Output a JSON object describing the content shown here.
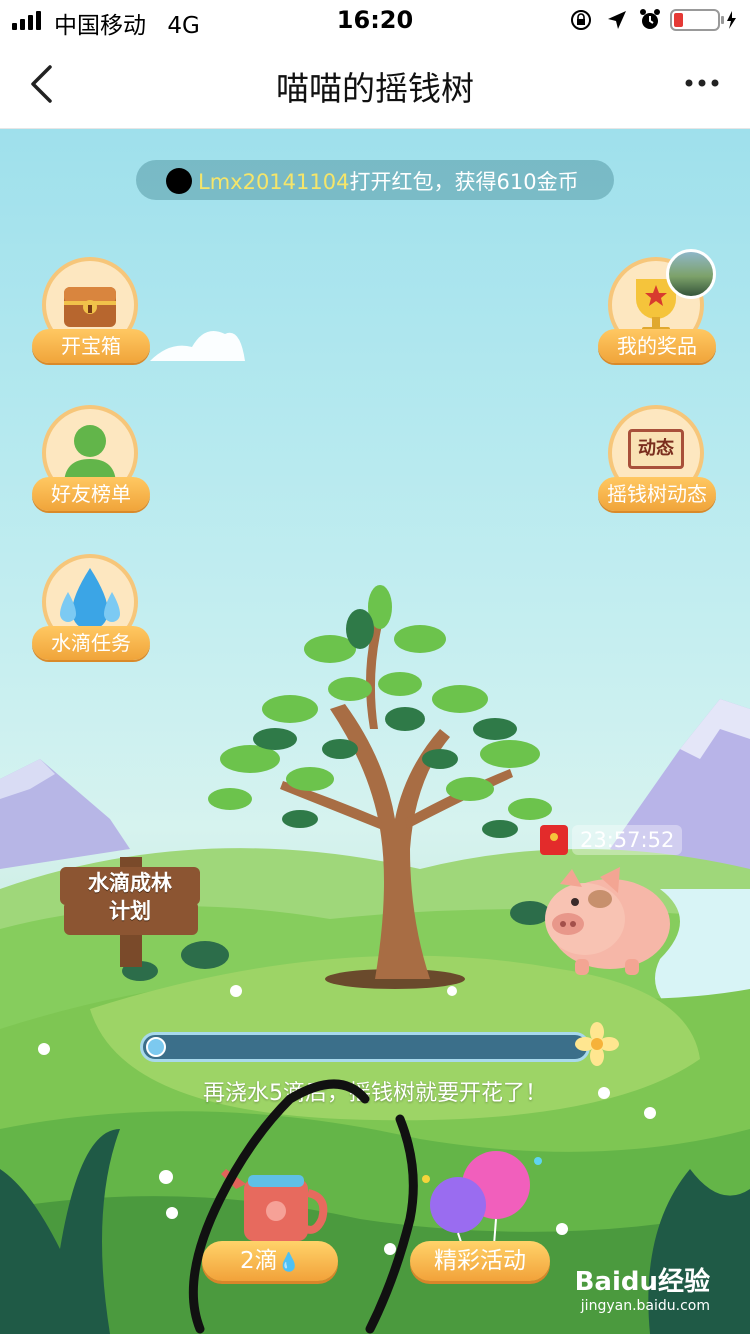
{
  "status_bar": {
    "carrier": "中国移动",
    "network": "4G",
    "time": "16:20"
  },
  "nav": {
    "title": "喵喵的摇钱树"
  },
  "banner": {
    "user": "Lmx20141104",
    "message": "打开红包，获得610金币"
  },
  "side_buttons": {
    "treasure": "开宝箱",
    "friends": "好友榜单",
    "water_tasks": "水滴任务",
    "prizes": "我的奖品",
    "dynamics": "摇钱树动态",
    "dynamics_icon_text": "动态"
  },
  "sign": {
    "line1": "水滴成林",
    "line2": "计划"
  },
  "pig": {
    "countdown": "23:57:52"
  },
  "progress": {
    "fraction": 0.0,
    "hint": "再浇水5滴后，摇钱树就要开花了！"
  },
  "bottom": {
    "water_label": "2滴",
    "events_label": "精彩活动"
  },
  "watermark": {
    "brand": "Baidu经验",
    "url": "jingyan.baidu.com"
  },
  "colors": {
    "accent_orange": "#f0a43a",
    "sky": "#b5e9ef",
    "grass": "#7cc44a"
  }
}
